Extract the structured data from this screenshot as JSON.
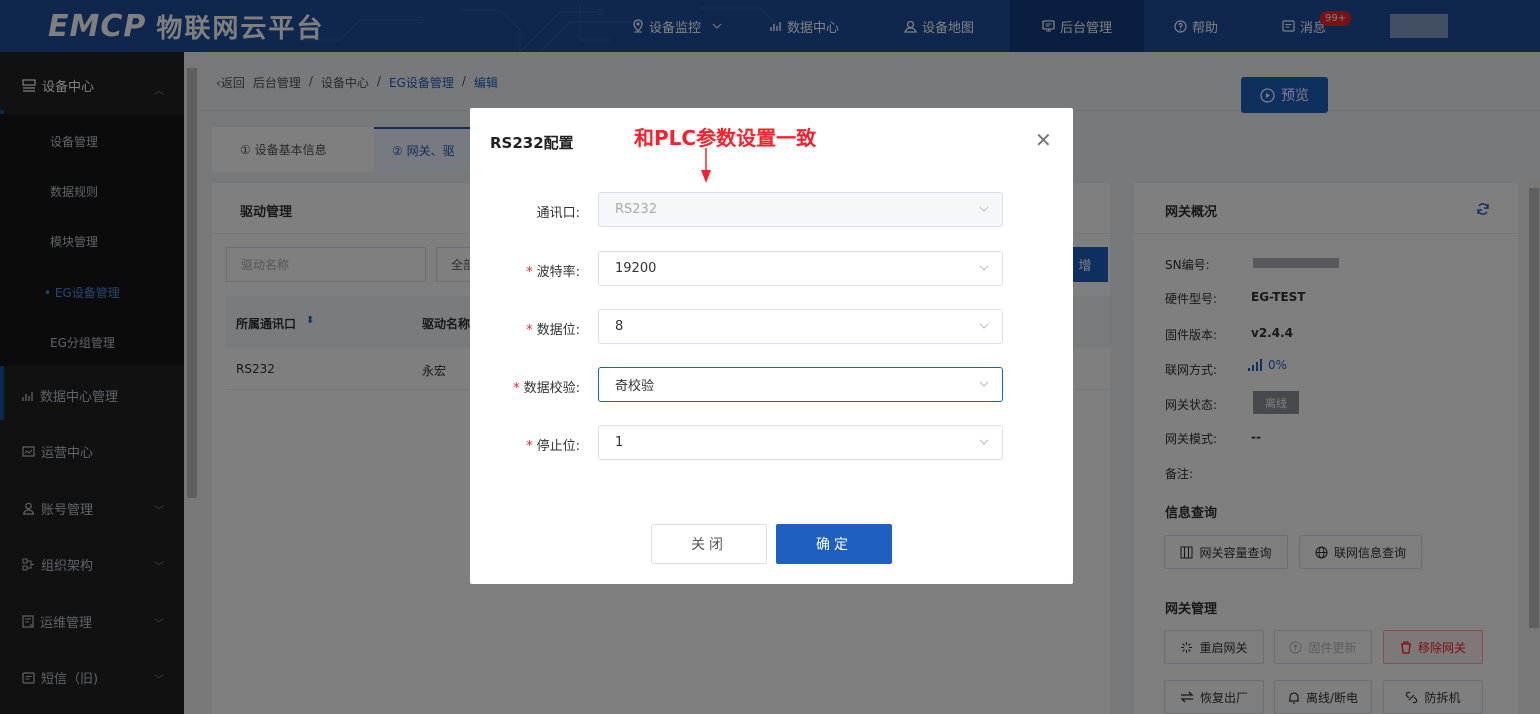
{
  "header": {
    "logo_mark": "EMCP",
    "logo_text": "物联网云平台",
    "nav": [
      {
        "label": "设备监控",
        "icon": "location-icon"
      },
      {
        "label": "数据中心",
        "icon": "chart-icon"
      },
      {
        "label": "设备地图",
        "icon": "user-pin-icon"
      },
      {
        "label": "后台管理",
        "icon": "monitor-icon"
      },
      {
        "label": "帮助",
        "icon": "help-icon"
      },
      {
        "label": "消息",
        "icon": "message-icon"
      }
    ],
    "message_badge": "99+"
  },
  "sidebar": {
    "device_center": "设备中心",
    "items": [
      "设备管理",
      "数据规则",
      "模块管理",
      "EG设备管理",
      "EG分组管理"
    ],
    "active_item": "EG设备管理",
    "sections": [
      "数据中心管理",
      "运营中心",
      "账号管理",
      "组织架构",
      "运维管理",
      "短信（旧)"
    ]
  },
  "breadcrumb": {
    "back": "返回",
    "parts": [
      "后台管理",
      "设备中心",
      "EG设备管理",
      "编辑"
    ]
  },
  "steps": {
    "step1": "① 设备基本信息",
    "step2": "② 网关、驱"
  },
  "preview_button": "预览",
  "driver": {
    "title": "驱动管理",
    "search_placeholder": "驱动名称",
    "filter_partial": "全部",
    "add_partial": "增",
    "columns": [
      "所属通讯口",
      "驱动名称"
    ],
    "rows": [
      {
        "port": "RS232",
        "name": "永宏"
      }
    ]
  },
  "gateway": {
    "title": "网关概况",
    "fields": [
      {
        "label": "SN编号:",
        "value": ""
      },
      {
        "label": "硬件型号:",
        "value": "EG-TEST"
      },
      {
        "label": "固件版本:",
        "value": "v2.4.4"
      },
      {
        "label": "联网方式:",
        "value": "0%"
      },
      {
        "label": "网关状态:",
        "value": "离线"
      },
      {
        "label": "网关模式:",
        "value": "--"
      },
      {
        "label": "备注:",
        "value": ""
      }
    ],
    "info_title": "信息查询",
    "info_buttons": [
      "网关容量查询",
      "联网信息查询"
    ],
    "manage_title": "网关管理",
    "manage_buttons": [
      "重启网关",
      "固件更新",
      "移除网关",
      "恢复出厂",
      "离线/断电",
      "防拆机"
    ]
  },
  "modal": {
    "title": "RS232配置",
    "annotation": "和PLC参数设置一致",
    "fields": [
      {
        "label": "通讯口:",
        "value": "RS232",
        "required": false
      },
      {
        "label": "波特率:",
        "value": "19200",
        "required": true
      },
      {
        "label": "数据位:",
        "value": "8",
        "required": true
      },
      {
        "label": "数据校验:",
        "value": "奇校验",
        "required": true
      },
      {
        "label": "停止位:",
        "value": "1",
        "required": true
      }
    ],
    "cancel": "关闭",
    "confirm": "确定"
  },
  "colors": {
    "primary": "#1f5fbf",
    "header": "#1f4f9e",
    "sidebar": "#232324",
    "annotation": "#f5222d"
  }
}
